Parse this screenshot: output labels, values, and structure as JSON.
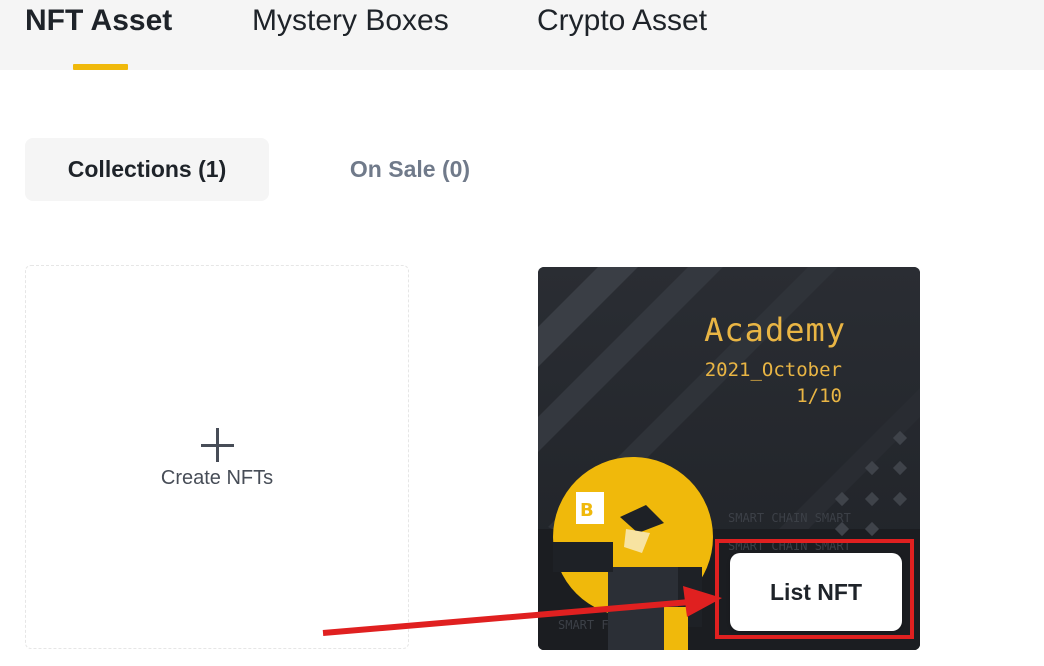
{
  "top_tabs": [
    {
      "label": "NFT Asset",
      "active": true
    },
    {
      "label": "Mystery Boxes",
      "active": false
    },
    {
      "label": "Crypto Asset",
      "active": false
    }
  ],
  "sub_tabs": [
    {
      "label": "Collections (1)",
      "active": true
    },
    {
      "label": "On Sale (0)",
      "active": false
    }
  ],
  "create_card": {
    "label": "Create NFTs",
    "icon": "plus-icon"
  },
  "nft_card": {
    "title": "Academy",
    "subtitle": "2021_October",
    "edition": "1/10",
    "action_label": "List NFT"
  },
  "colors": {
    "accent": "#f0b90b",
    "nft_text": "#e9b544",
    "annotation": "#e02020"
  }
}
